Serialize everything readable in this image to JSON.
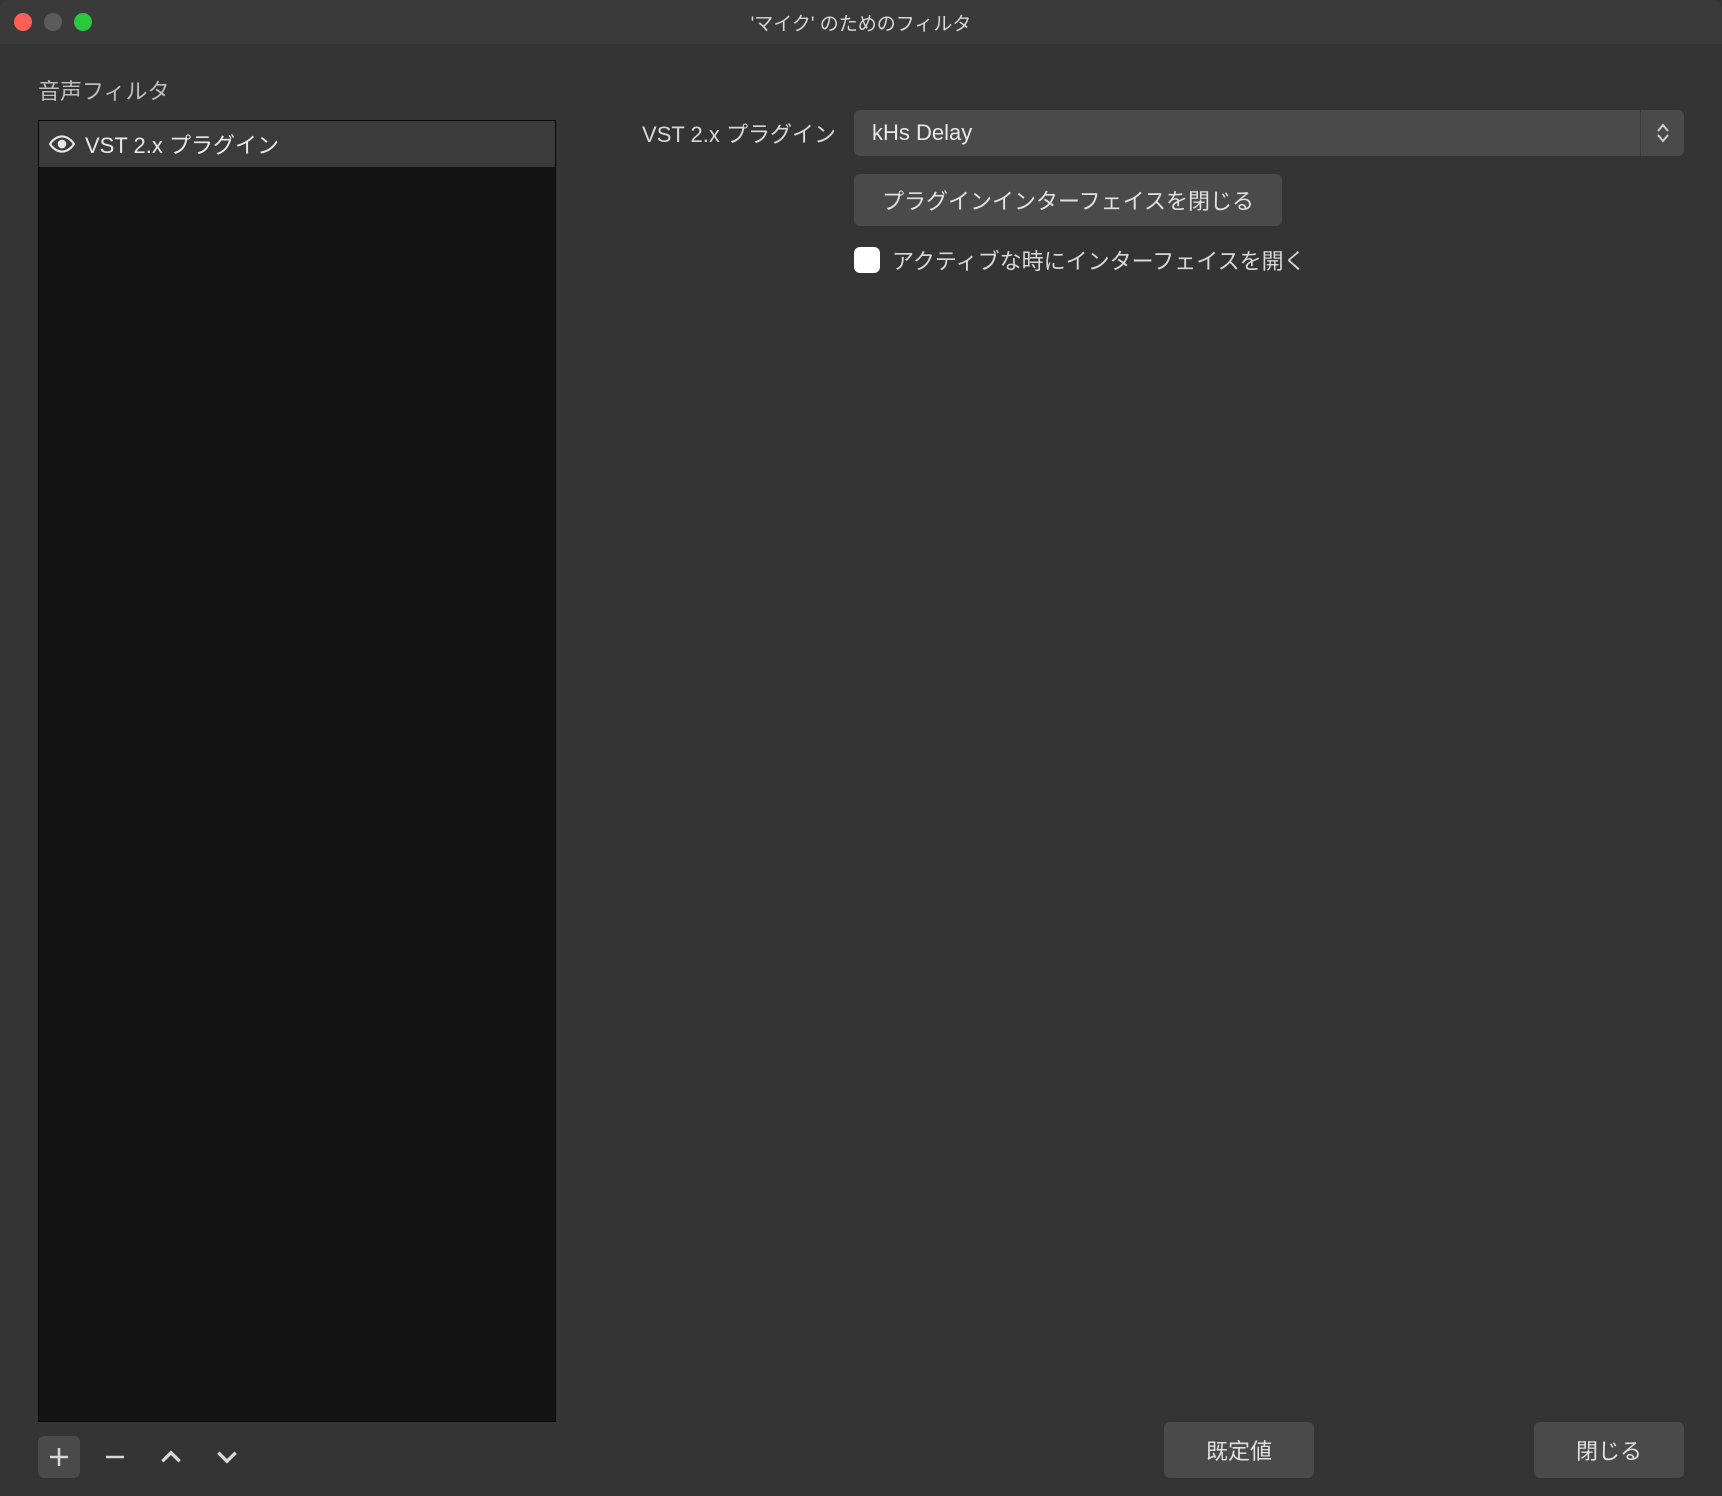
{
  "window": {
    "title": "'マイク' のためのフィルタ"
  },
  "sidebar": {
    "heading": "音声フィルタ",
    "items": [
      {
        "label": "VST 2.x プラグイン",
        "visible": true
      }
    ]
  },
  "detail": {
    "plugin_label": "VST 2.x プラグイン",
    "plugin_select": {
      "selected": "kHs Delay"
    },
    "close_interface_button": "プラグインインターフェイスを閉じる",
    "open_on_active_checkbox": {
      "label": "アクティブな時にインターフェイスを開く",
      "checked": false
    }
  },
  "footer": {
    "defaults_button": "既定値",
    "close_button": "閉じる"
  }
}
